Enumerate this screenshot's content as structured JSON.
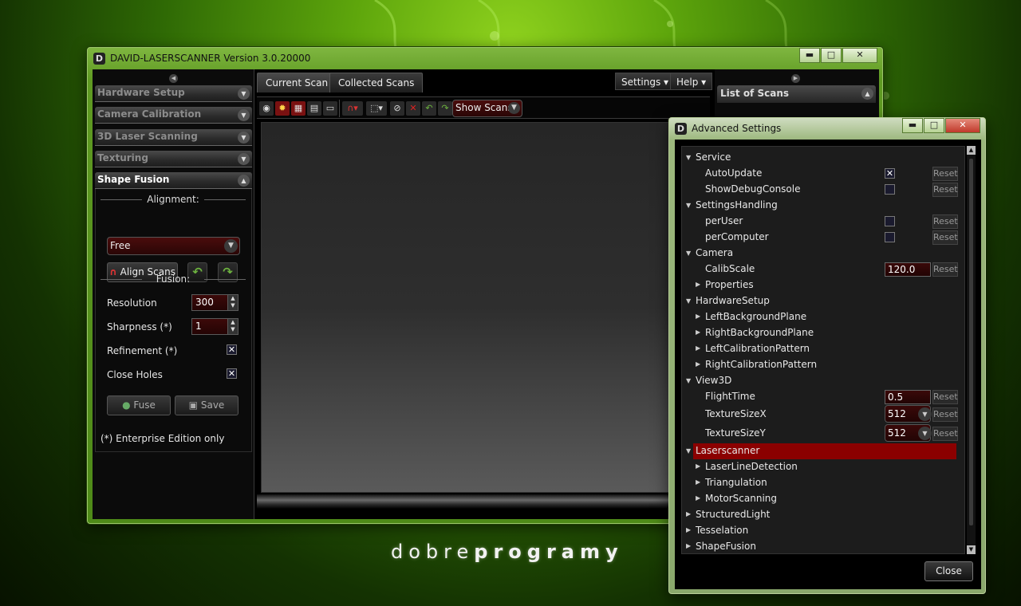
{
  "brand": {
    "part1": "dobre",
    "part2": "programy"
  },
  "main_window": {
    "title": "DAVID-LASERSCANNER Version 3.0.20000",
    "logo": "D",
    "buttons": {
      "minimize": "▬",
      "maximize": "□",
      "close": "✕"
    }
  },
  "sidebar": {
    "sections": [
      {
        "label": "Hardware Setup"
      },
      {
        "label": "Camera Calibration"
      },
      {
        "label": "3D Laser Scanning"
      },
      {
        "label": "Texturing"
      },
      {
        "label": "Shape Fusion"
      }
    ],
    "alignment_heading": "Alignment:",
    "alignment_mode": "Free",
    "align_scans_label": "Align Scans",
    "fusion_heading": "Fusion:",
    "resolution_label": "Resolution",
    "resolution_value": "300",
    "sharpness_label": "Sharpness (*)",
    "sharpness_value": "1",
    "refinement_label": "Refinement (*)",
    "refinement_checked": true,
    "close_holes_label": "Close Holes",
    "close_holes_checked": true,
    "fuse_label": "Fuse",
    "save_label": "Save",
    "footnote": "(*) Enterprise Edition only"
  },
  "tabs": [
    {
      "label": "Current Scan"
    },
    {
      "label": "Collected Scans"
    }
  ],
  "menus": {
    "settings": "Settings ▾",
    "help": "Help ▾"
  },
  "toolbar": {
    "show_scans": "Show Scans"
  },
  "list_panel": {
    "title": "List of Scans"
  },
  "advanced_settings": {
    "title": "Advanced Settings",
    "logo": "D",
    "reset_label": "Reset",
    "close_label": "Close",
    "rows": [
      {
        "label": "Service",
        "level": 0,
        "expanded": true
      },
      {
        "label": "AutoUpdate",
        "level": 1,
        "type": "checkbox",
        "checked": true,
        "reset": true
      },
      {
        "label": "ShowDebugConsole",
        "level": 1,
        "type": "checkbox",
        "checked": false,
        "reset": true
      },
      {
        "label": "SettingsHandling",
        "level": 0,
        "expanded": true
      },
      {
        "label": "perUser",
        "level": 1,
        "type": "checkbox",
        "checked": false,
        "reset": true
      },
      {
        "label": "perComputer",
        "level": 1,
        "type": "checkbox",
        "checked": false,
        "reset": true
      },
      {
        "label": "Camera",
        "level": 0,
        "expanded": true
      },
      {
        "label": "CalibScale",
        "level": 1,
        "type": "input",
        "value": "120.0",
        "reset": true
      },
      {
        "label": "Properties",
        "level": 1,
        "collapsed": true
      },
      {
        "label": "HardwareSetup",
        "level": 0,
        "expanded": true
      },
      {
        "label": "LeftBackgroundPlane",
        "level": 1,
        "collapsed": true
      },
      {
        "label": "RightBackgroundPlane",
        "level": 1,
        "collapsed": true
      },
      {
        "label": "LeftCalibrationPattern",
        "level": 1,
        "collapsed": true
      },
      {
        "label": "RightCalibrationPattern",
        "level": 1,
        "collapsed": true
      },
      {
        "label": "View3D",
        "level": 0,
        "expanded": true
      },
      {
        "label": "FlightTime",
        "level": 1,
        "type": "input",
        "value": "0.5",
        "reset": true
      },
      {
        "label": "TextureSizeX",
        "level": 1,
        "type": "combo",
        "value": "512",
        "reset": true
      },
      {
        "label": "TextureSizeY",
        "level": 1,
        "type": "combo",
        "value": "512",
        "reset": true
      },
      {
        "label": "Laserscanner",
        "level": 0,
        "expanded": true,
        "selected": true
      },
      {
        "label": "LaserLineDetection",
        "level": 1,
        "collapsed": true
      },
      {
        "label": "Triangulation",
        "level": 1,
        "collapsed": true
      },
      {
        "label": "MotorScanning",
        "level": 1,
        "collapsed": true
      },
      {
        "label": "StructuredLight",
        "level": 0,
        "collapsed": true
      },
      {
        "label": "Tesselation",
        "level": 0,
        "collapsed": true
      },
      {
        "label": "ShapeFusion",
        "level": 0,
        "collapsed": true
      }
    ]
  },
  "colors": {
    "accent_red": "#8b0000",
    "frame_green": "#6aa32a"
  }
}
